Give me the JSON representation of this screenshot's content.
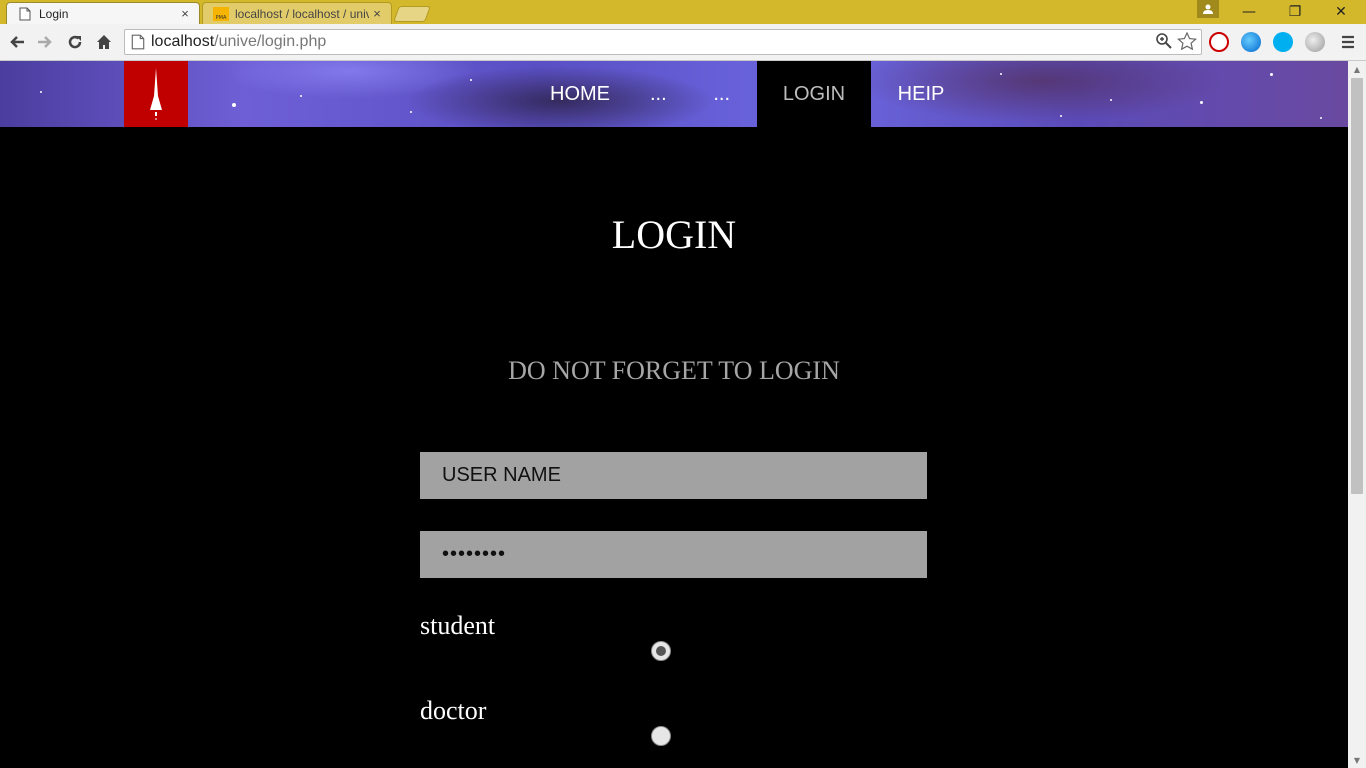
{
  "browser": {
    "tabs": [
      {
        "title": "Login",
        "favicon": "page-icon"
      },
      {
        "title": "localhost / localhost / unive",
        "favicon": "phpmyadmin-icon",
        "favicon_text": "PMA"
      }
    ],
    "url_host": "localhost",
    "url_path": "/unive/login.php",
    "window_controls": {
      "minimize": "—",
      "restore": "❐",
      "close": "✕"
    },
    "tab_close": "×"
  },
  "site": {
    "nav": [
      {
        "label": "HOME",
        "active": false
      },
      {
        "label": "...",
        "active": false
      },
      {
        "label": "...",
        "active": false
      },
      {
        "label": "LOGIN",
        "active": true
      },
      {
        "label": "HEIP",
        "active": false
      }
    ],
    "brand_color": "#c00000"
  },
  "login": {
    "title": "LOGIN",
    "subtitle": "DO NOT FORGET TO LOGIN",
    "username_value": "USER NAME",
    "password_value": "••••••••",
    "roles": [
      {
        "label": "student",
        "checked": true
      },
      {
        "label": "doctor",
        "checked": false
      }
    ]
  }
}
